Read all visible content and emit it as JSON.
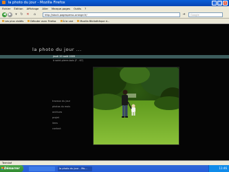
{
  "window": {
    "title": "la photo du jour - Mozilla Firefox",
    "controls": [
      "minimize-icon",
      "maximize-icon",
      "close-icon"
    ]
  },
  "menu": [
    "Fichier",
    "Édition",
    "Affichage",
    "Aller",
    "Marque-pages",
    "Outils",
    "?"
  ],
  "toolbar": {
    "url": "http://stock.pagesperso-orange.fr/",
    "search_placeholder": "Google"
  },
  "bookmarks": [
    "Les plus visités",
    "Débuter avec Firefox",
    "À la une",
    "Mozilla Bibliothèque d..."
  ],
  "site": {
    "title": "la photo du jour ...",
    "date": "jeudi 20 août 2009",
    "place": "à saint-pierre-bois (F - 67)",
    "nav": [
      "travaux du jour",
      "photos du mois",
      "archives",
      "projet",
      "liens",
      "contact"
    ],
    "photo_icon": "photo-father-child-in-park"
  },
  "status": "Terminé",
  "taskbar": {
    "start": "Démarrer",
    "tasks": [
      "",
      "la photo du jour - Mo..."
    ],
    "clock": "11:46"
  },
  "colors": {
    "page_bg": "#050505",
    "band": "#3c5c5c",
    "titlebar": "#0a5fd8"
  }
}
